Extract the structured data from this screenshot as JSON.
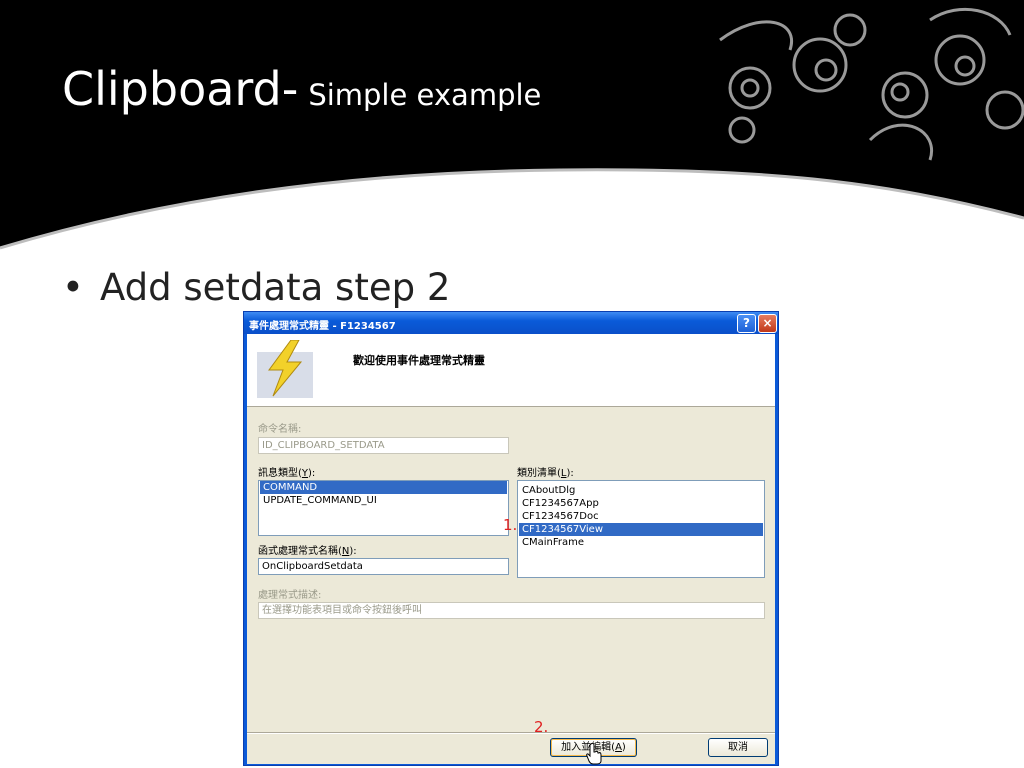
{
  "slide": {
    "title_main": "Clipboard-",
    "title_sub": "Simple example",
    "bullet_symbol": "•",
    "bullet_text": "Add setdata step 2"
  },
  "dialog": {
    "title": "事件處理常式精靈 - F1234567",
    "help_button": "?",
    "close_button": "×",
    "welcome_text": "歡迎使用事件處理常式精靈",
    "command_name_label": "命令名稱:",
    "command_name_value": "ID_CLIPBOARD_SETDATA",
    "message_type_label": "訊息類型(",
    "message_type_key": "Y",
    "message_type_tail": "):",
    "message_types": [
      "COMMAND",
      "UPDATE_COMMAND_UI"
    ],
    "selected_message_type": "COMMAND",
    "class_list_label": "類別清單(",
    "class_list_key": "L",
    "class_list_tail": "):",
    "classes": [
      "CAboutDlg",
      "CF1234567App",
      "CF1234567Doc",
      "CF1234567View",
      "CMainFrame"
    ],
    "selected_class": "CF1234567View",
    "handler_name_label": "函式處理常式名稱(",
    "handler_name_key": "N",
    "handler_name_tail": "):",
    "handler_name_value": "OnClipboardSetdata",
    "description_label": "處理常式描述:",
    "description_value": "在選擇功能表項目或命令按鈕後呼叫",
    "add_edit_button": "加入並編輯(",
    "add_edit_key": "A",
    "add_edit_tail": ")",
    "cancel_button": "取消"
  },
  "annotations": {
    "step1": "1.",
    "step2": "2."
  },
  "colors": {
    "header_bg": "#000000",
    "title_text": "#ffffff",
    "xp_title_blue": "#0a5bd9",
    "selection": "#316ac5",
    "dialog_face": "#ece9d8",
    "marker_red": "#e02020"
  }
}
